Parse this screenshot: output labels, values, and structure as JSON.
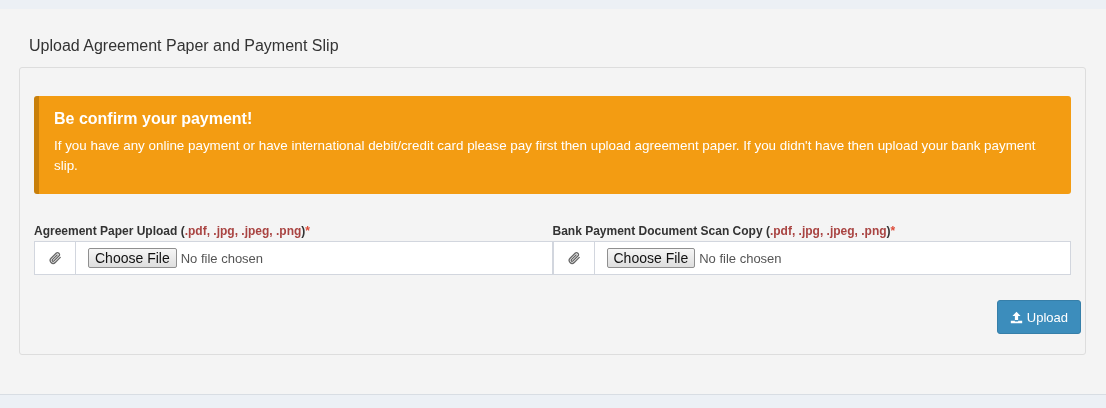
{
  "panel": {
    "title": "Upload Agreement Paper and Payment Slip"
  },
  "alert": {
    "title": "Be confirm your payment!",
    "message": "If you have any online payment or have international debit/credit card please pay first then upload agreement paper. If you didn't have then upload your bank payment slip."
  },
  "uploads": [
    {
      "label": "Agreement Paper Upload (",
      "formats": ".pdf, .jpg, .jpeg, .png",
      "label_end": ")",
      "required_mark": "*",
      "button": "Choose File",
      "status": "No file chosen"
    },
    {
      "label": "Bank Payment Document Scan Copy (",
      "formats": ".pdf, .jpg, .jpeg, .png",
      "label_end": ")",
      "required_mark": "*",
      "button": "Choose File",
      "status": "No file chosen"
    }
  ],
  "submit": {
    "label": "Upload"
  }
}
